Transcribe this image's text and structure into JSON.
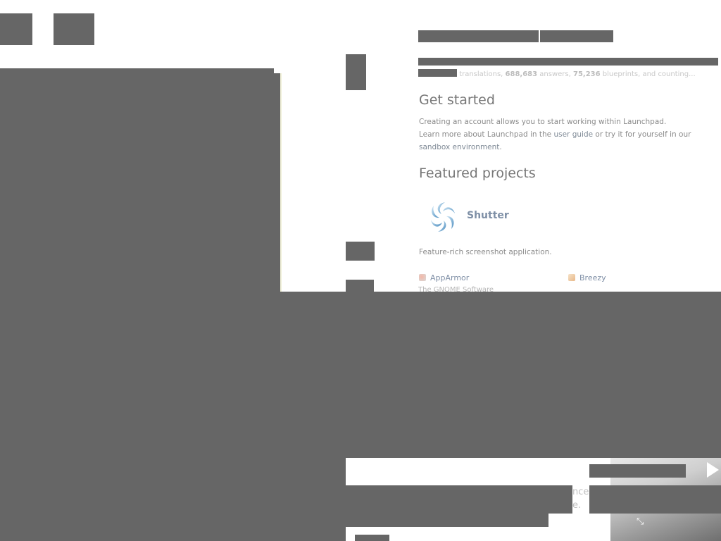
{
  "stats": {
    "translations_label": "translations,",
    "answers_count": "688,683",
    "answers_label": "answers,",
    "blueprints_count": "75,236",
    "blueprints_label": "blueprints, and counting..."
  },
  "get_started": {
    "heading": "Get started",
    "line1": "Creating an account allows you to start working within Launchpad.",
    "line2_prefix": "Learn more about Launchpad in the ",
    "user_guide_link": "user guide",
    "line2_middle": " or try it for yourself in our",
    "sandbox_link": "sandbox environment",
    "line3_suffix": "."
  },
  "featured": {
    "heading": "Featured projects",
    "highlight": {
      "name": "Shutter",
      "description": "Feature-rich screenshot application."
    },
    "projects": [
      {
        "name": "AppArmor",
        "icon": "apparmor-icon"
      },
      {
        "name": "Breezy",
        "icon": "breezy-icon"
      }
    ],
    "clipped_row_text": "The GNOME Software"
  },
  "overlay": {
    "line1_fragment": "nce",
    "line2_fragment": "e."
  },
  "colors": {
    "redaction": "#666666",
    "link": "#7f8fa6",
    "heading": "#777777",
    "body_text": "#8a8a8a"
  }
}
